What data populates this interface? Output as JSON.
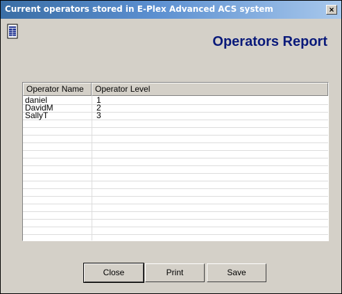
{
  "window": {
    "title": "Current operators stored in E-Plex Advanced ACS system",
    "close_glyph": "×"
  },
  "report": {
    "title": "Operators Report",
    "icon": "report-document-icon"
  },
  "table": {
    "columns": [
      "Operator Name",
      "Operator Level"
    ],
    "rows": [
      {
        "name": "daniel",
        "level": "1"
      },
      {
        "name": "DavidM",
        "level": "2"
      },
      {
        "name": "SallyT",
        "level": "3"
      }
    ]
  },
  "buttons": {
    "close": "Close",
    "print": "Print",
    "save": "Save"
  },
  "colors": {
    "title_accent": "#0a1a7a",
    "dialog_bg": "#d4d0c8"
  }
}
